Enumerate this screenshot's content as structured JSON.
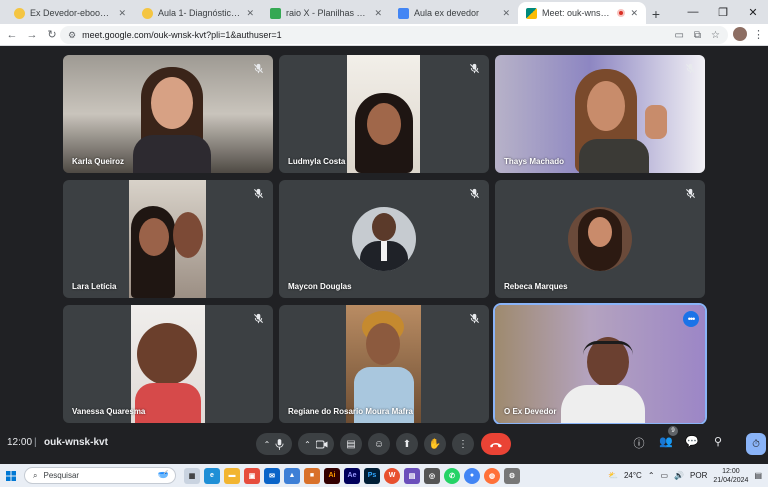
{
  "browser": {
    "tabs": [
      {
        "label": "Ex Devedor-ebook.pdf - Ex De",
        "color": "#e8b4a8",
        "active": false
      },
      {
        "label": "Aula 1- Diagnóstico Financeiro",
        "color": "#f6d365",
        "active": false
      },
      {
        "label": "raio X - Planilhas Google",
        "color": "#34a853",
        "active": false
      },
      {
        "label": "Aula ex devedor",
        "color": "#4285f4",
        "active": false
      },
      {
        "label": "Meet: ouk-wnsk-kvt",
        "color": "#00897b",
        "active": true
      }
    ],
    "url": "meet.google.com/ouk-wnsk-kvt?pli=1&authuser=1",
    "new_tab": "+",
    "window_controls": {
      "minimize": "—",
      "maximize": "❐",
      "close": "✕"
    },
    "nav": {
      "back": "←",
      "forward": "→",
      "reload": "↻"
    }
  },
  "meet": {
    "participants": [
      {
        "name": "Karla Queiroz",
        "muted": true
      },
      {
        "name": "Ludmyla Costa",
        "muted": true
      },
      {
        "name": "Thays Machado",
        "muted": true
      },
      {
        "name": "Lara Letícia",
        "muted": true
      },
      {
        "name": "Maycon Douglas",
        "muted": true
      },
      {
        "name": "Rebeca Marques",
        "muted": true
      },
      {
        "name": "Vanessa Quaresma",
        "muted": true
      },
      {
        "name": "Regiane do Rosario Moura Mafra",
        "muted": true
      },
      {
        "name": "O Ex Devedor",
        "muted": false,
        "speaking": true
      }
    ],
    "bottom_bar": {
      "time": "12:00",
      "separator": "|",
      "meeting_code": "ouk-wnsk-kvt",
      "people_count": "9"
    },
    "colors": {
      "accent": "#8ab4f8",
      "end_call": "#ea4335",
      "tile": "#3c4043",
      "background": "#202124"
    }
  },
  "taskbar": {
    "search_placeholder": "Pesquisar",
    "weather": "24°C",
    "language": "POR",
    "clock_time": "12:00",
    "clock_date": "21/04/2024"
  }
}
